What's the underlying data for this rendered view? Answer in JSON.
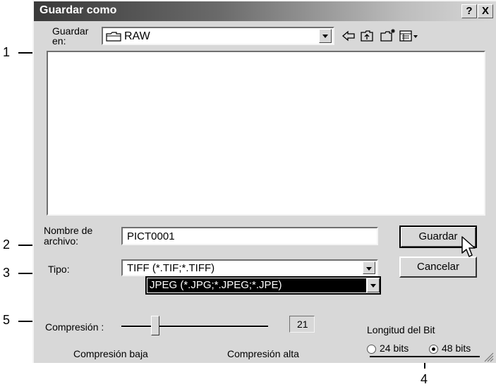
{
  "callouts": [
    "1",
    "2",
    "3",
    "4",
    "5"
  ],
  "dialog": {
    "title": "Guardar como",
    "help_btn": "?",
    "close_btn": "X",
    "save_in_label_1": "Guardar",
    "save_in_label_2": "en:",
    "save_in_value": "RAW",
    "filename_label_1": "Nombre de",
    "filename_label_2": "archivo:",
    "filename_value": "PICT0001",
    "type_label": "Tipo:",
    "type_value": "TIFF (*.TIF;*.TIFF)",
    "type_dropdown_option": "JPEG (*.JPG;*.JPEG;*.JPE)",
    "save_button": "Guardar",
    "cancel_button": "Cancelar",
    "compression_label": "Compresión :",
    "compression_value": "21",
    "compression_low": "Compresión baja",
    "compression_high": "Compresión alta",
    "bit_depth_label": "Longitud del Bit",
    "bit_24": "24 bits",
    "bit_48": "48 bits",
    "selected_bit": "48 bits"
  }
}
